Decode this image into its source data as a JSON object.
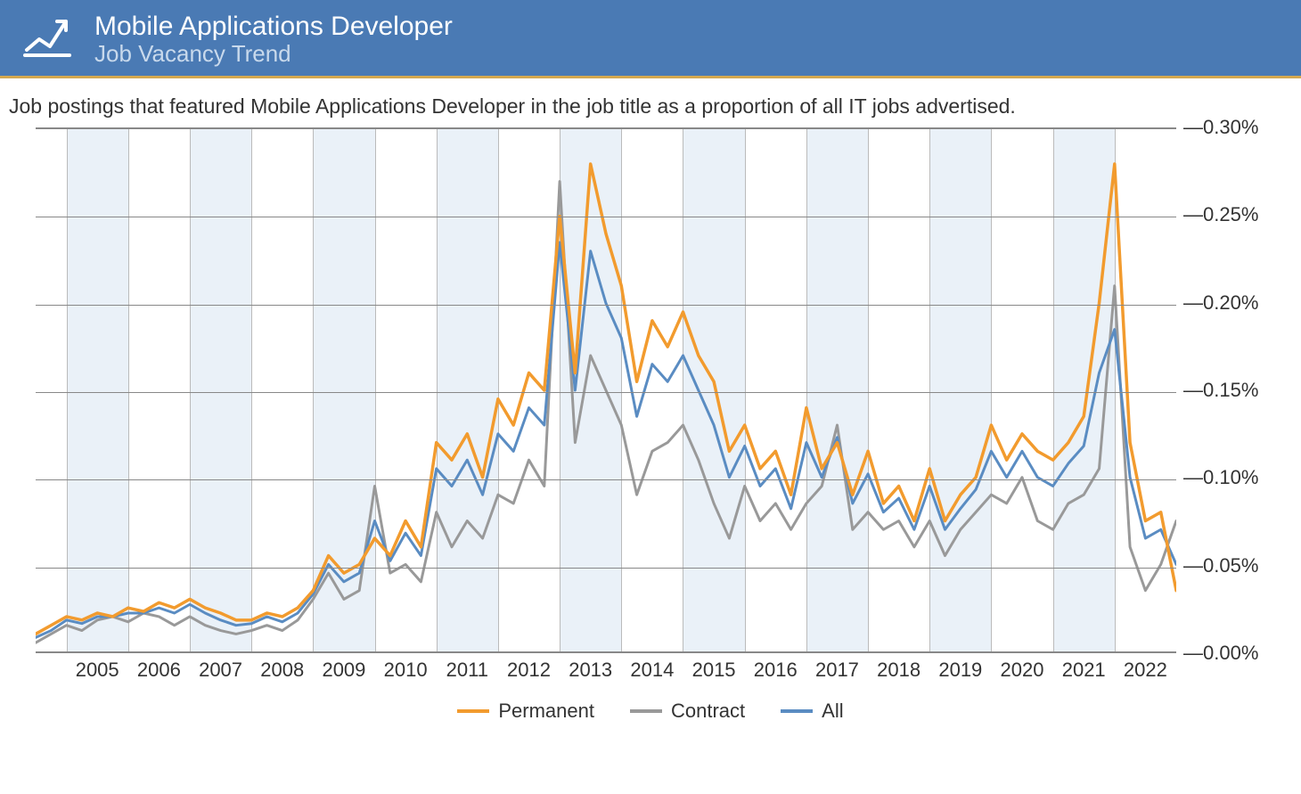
{
  "header": {
    "title": "Mobile Applications Developer",
    "subtitle": "Job Vacancy Trend"
  },
  "description": "Job postings that featured Mobile Applications Developer in the job title as a proportion of all IT jobs advertised.",
  "legend": {
    "permanent": "Permanent",
    "contract": "Contract",
    "all": "All"
  },
  "chart_data": {
    "type": "line",
    "title": "Mobile Applications Developer Job Vacancy Trend",
    "xlabel": "",
    "ylabel": "",
    "ylim": [
      0,
      0.3
    ],
    "y_ticks": [
      "0.00%",
      "0.05%",
      "0.10%",
      "0.15%",
      "0.20%",
      "0.25%",
      "0.30%"
    ],
    "x_ticks": [
      "2005",
      "2006",
      "2007",
      "2008",
      "2009",
      "2010",
      "2011",
      "2012",
      "2013",
      "2014",
      "2015",
      "2016",
      "2017",
      "2018",
      "2019",
      "2020",
      "2021",
      "2022"
    ],
    "x_range": [
      2004.5,
      2023.0
    ],
    "colors": {
      "Permanent": "#f29b2e",
      "Contract": "#999999",
      "All": "#5a8cc2"
    },
    "x": [
      2004.5,
      2004.75,
      2005.0,
      2005.25,
      2005.5,
      2005.75,
      2006.0,
      2006.25,
      2006.5,
      2006.75,
      2007.0,
      2007.25,
      2007.5,
      2007.75,
      2008.0,
      2008.25,
      2008.5,
      2008.75,
      2009.0,
      2009.25,
      2009.5,
      2009.75,
      2010.0,
      2010.25,
      2010.5,
      2010.75,
      2011.0,
      2011.25,
      2011.5,
      2011.75,
      2012.0,
      2012.25,
      2012.5,
      2012.75,
      2013.0,
      2013.25,
      2013.5,
      2013.75,
      2014.0,
      2014.25,
      2014.5,
      2014.75,
      2015.0,
      2015.25,
      2015.5,
      2015.75,
      2016.0,
      2016.25,
      2016.5,
      2016.75,
      2017.0,
      2017.25,
      2017.5,
      2017.75,
      2018.0,
      2018.25,
      2018.5,
      2018.75,
      2019.0,
      2019.25,
      2019.5,
      2019.75,
      2020.0,
      2020.25,
      2020.5,
      2020.75,
      2021.0,
      2021.25,
      2021.5,
      2021.75,
      2022.0,
      2022.25,
      2022.5,
      2022.75,
      2023.0
    ],
    "series": [
      {
        "name": "Permanent",
        "values": [
          0.01,
          0.015,
          0.02,
          0.018,
          0.022,
          0.02,
          0.025,
          0.023,
          0.028,
          0.025,
          0.03,
          0.025,
          0.022,
          0.018,
          0.018,
          0.022,
          0.02,
          0.025,
          0.035,
          0.055,
          0.045,
          0.05,
          0.065,
          0.055,
          0.075,
          0.06,
          0.12,
          0.11,
          0.125,
          0.1,
          0.145,
          0.13,
          0.16,
          0.15,
          0.25,
          0.16,
          0.28,
          0.24,
          0.21,
          0.155,
          0.19,
          0.175,
          0.195,
          0.17,
          0.155,
          0.115,
          0.13,
          0.105,
          0.115,
          0.09,
          0.14,
          0.105,
          0.12,
          0.09,
          0.115,
          0.085,
          0.095,
          0.075,
          0.105,
          0.075,
          0.09,
          0.1,
          0.13,
          0.11,
          0.125,
          0.115,
          0.11,
          0.12,
          0.135,
          0.2,
          0.28,
          0.12,
          0.075,
          0.08,
          0.035
        ]
      },
      {
        "name": "Contract",
        "values": [
          0.005,
          0.01,
          0.015,
          0.012,
          0.018,
          0.02,
          0.017,
          0.022,
          0.02,
          0.015,
          0.02,
          0.015,
          0.012,
          0.01,
          0.012,
          0.015,
          0.012,
          0.018,
          0.03,
          0.045,
          0.03,
          0.035,
          0.095,
          0.045,
          0.05,
          0.04,
          0.08,
          0.06,
          0.075,
          0.065,
          0.09,
          0.085,
          0.11,
          0.095,
          0.27,
          0.12,
          0.17,
          0.15,
          0.13,
          0.09,
          0.115,
          0.12,
          0.13,
          0.11,
          0.085,
          0.065,
          0.095,
          0.075,
          0.085,
          0.07,
          0.085,
          0.095,
          0.13,
          0.07,
          0.08,
          0.07,
          0.075,
          0.06,
          0.075,
          0.055,
          0.07,
          0.08,
          0.09,
          0.085,
          0.1,
          0.075,
          0.07,
          0.085,
          0.09,
          0.105,
          0.21,
          0.06,
          0.035,
          0.05,
          0.075
        ]
      },
      {
        "name": "All",
        "values": [
          0.008,
          0.012,
          0.018,
          0.016,
          0.02,
          0.02,
          0.022,
          0.022,
          0.025,
          0.022,
          0.027,
          0.022,
          0.018,
          0.015,
          0.016,
          0.02,
          0.017,
          0.022,
          0.033,
          0.05,
          0.04,
          0.045,
          0.075,
          0.052,
          0.068,
          0.055,
          0.105,
          0.095,
          0.11,
          0.09,
          0.125,
          0.115,
          0.14,
          0.13,
          0.235,
          0.15,
          0.23,
          0.2,
          0.18,
          0.135,
          0.165,
          0.155,
          0.17,
          0.15,
          0.13,
          0.1,
          0.118,
          0.095,
          0.105,
          0.082,
          0.12,
          0.1,
          0.123,
          0.085,
          0.102,
          0.08,
          0.088,
          0.07,
          0.095,
          0.07,
          0.082,
          0.093,
          0.115,
          0.1,
          0.115,
          0.1,
          0.095,
          0.108,
          0.118,
          0.16,
          0.185,
          0.1,
          0.065,
          0.07,
          0.05
        ]
      }
    ]
  }
}
